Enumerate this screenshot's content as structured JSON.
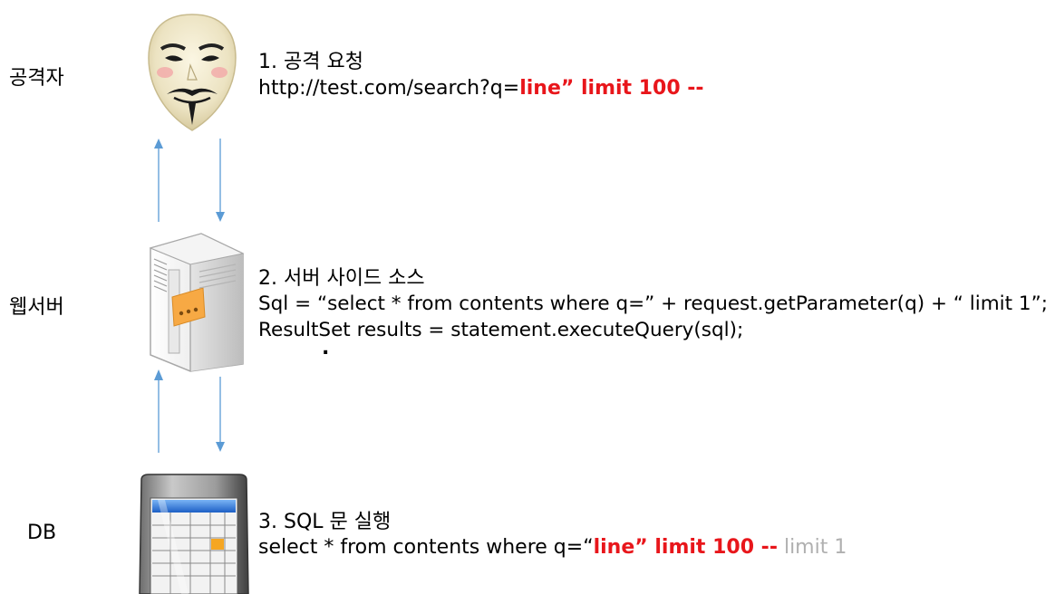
{
  "actors": {
    "attacker": "공격자",
    "webserver": "웹서버",
    "db": "DB"
  },
  "step1": {
    "title": "1. 공격 요청",
    "url_prefix": "http://test.com/search?q=",
    "injected": "line”  limit 100 --"
  },
  "step2": {
    "title": "2. 서버 사이드 소스",
    "line1": "Sql = “select * from contents where q=” + request.getParameter(q) + “ limit 1”;",
    "line2": "ResultSet results = statement.executeQuery(sql);",
    "line3": "."
  },
  "step3": {
    "title": "3. SQL 문 실행",
    "query_prefix": "select * from contents where q=“",
    "injected": "line” limit 100 --",
    "ignored": "limit 1"
  },
  "colors": {
    "arrow": "#5b9bd5",
    "injected": "#e8161b",
    "ignored": "#b0b0b0"
  },
  "icons": {
    "attacker": "guy-fawkes-mask-icon",
    "webserver": "server-tower-icon",
    "db": "database-table-icon"
  }
}
